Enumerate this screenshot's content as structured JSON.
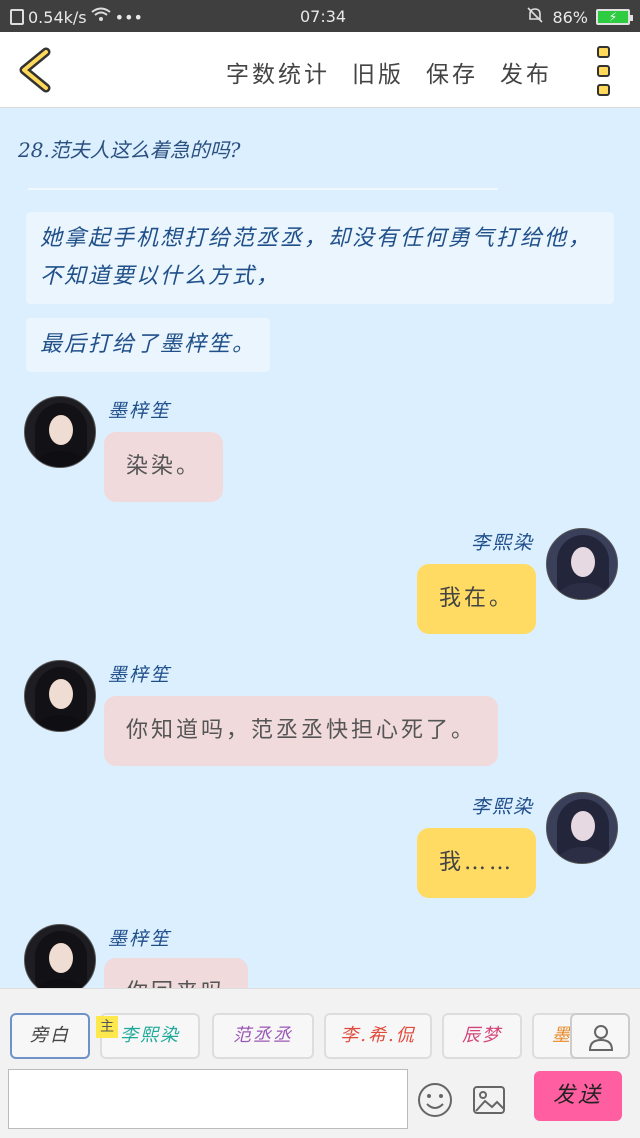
{
  "statusbar": {
    "network_speed": "0.54k/s",
    "time": "07:34",
    "battery": "86%"
  },
  "header": {
    "menu": [
      "字数统计",
      "旧版",
      "保存",
      "发布"
    ]
  },
  "chat": {
    "chapter_title": "28.范夫人这么着急的吗?",
    "narration": [
      "她拿起手机想打给范丞丞，却没有任何勇气打给他，不知道要以什么方式，",
      "最后打给了墨梓笙。"
    ],
    "messages": [
      {
        "speaker": "墨梓笙",
        "text": "染染。"
      },
      {
        "speaker": "李熙染",
        "text": "我在。"
      },
      {
        "speaker": "墨梓笙",
        "text": "你知道吗，范丞丞快担心死了。"
      },
      {
        "speaker": "李熙染",
        "text": "我……"
      },
      {
        "speaker": "墨梓笙",
        "text": "你回来吗"
      }
    ]
  },
  "bottom": {
    "roles": [
      "旁白",
      "李熙染",
      "范丞丞",
      "李.希.侃",
      "辰梦",
      "墨"
    ],
    "main_badge": "主",
    "input_placeholder": "",
    "send_label": "发送"
  },
  "colors": {
    "chat_background": "#dcefff",
    "pink_bubble": "#f0dadb",
    "yellow_bubble": "#ffdb63",
    "send_button": "#ff5fa0",
    "role_colors": [
      "#444444",
      "#20a99a",
      "#9b59b6",
      "#e04a3a",
      "#d4467a",
      "#e88a2a"
    ]
  },
  "icons": [
    "back-chevron-icon",
    "more-icon",
    "user-icon",
    "emoji-icon",
    "image-icon",
    "wifi-icon",
    "bell-off-icon",
    "battery-icon"
  ]
}
